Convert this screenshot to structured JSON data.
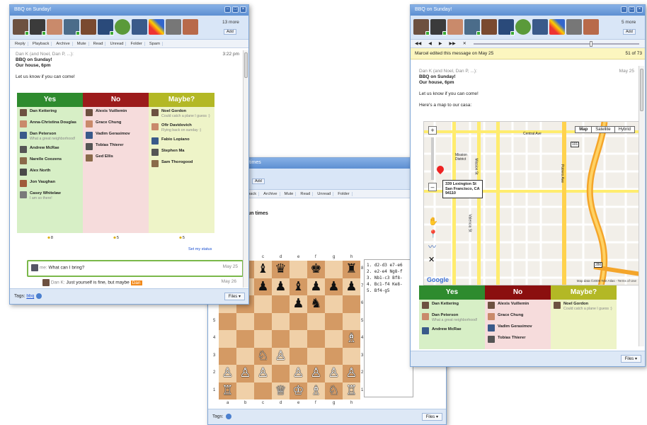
{
  "window_left": {
    "title": "BBQ on Sunday!",
    "more": "13 more",
    "add": "Add",
    "toolbar": [
      "Reply",
      "Playback",
      "Archive",
      "Mute",
      "Read",
      "Unread",
      "Folder",
      "Spam"
    ],
    "from": "Dan K (and Noel, Dan P, ...):",
    "time": "3:22 pm",
    "subject": "BBQ on Sunday!",
    "location": "Our house, 6pm",
    "body": "Let us know if you can come!",
    "poll": {
      "yes": {
        "label": "Yes",
        "color": "#2e8b2e",
        "items": [
          {
            "name": "Dan Kettering",
            "note": ""
          },
          {
            "name": "Anna-Christina Douglas",
            "note": ""
          },
          {
            "name": "Dan Peterson",
            "note": "What a great neighborhood!"
          },
          {
            "name": "Andrew McRae",
            "note": ""
          },
          {
            "name": "Narelle Coozens",
            "note": ""
          },
          {
            "name": "Alex North",
            "note": ""
          },
          {
            "name": "Jon Vaughan",
            "note": ""
          },
          {
            "name": "Casey Whitelaw",
            "note": "I am so there!"
          }
        ],
        "count": "8"
      },
      "no": {
        "label": "No",
        "color": "#a01f1f",
        "items": [
          {
            "name": "Alexis Vuillemin",
            "note": ""
          },
          {
            "name": "Grace Chung",
            "note": ""
          },
          {
            "name": "Vadim Gerasimov",
            "note": ""
          },
          {
            "name": "Tobias Thierer",
            "note": ""
          },
          {
            "name": "Ged Ellis",
            "note": ""
          }
        ],
        "count": "5"
      },
      "maybe": {
        "label": "Maybe?",
        "color": "#b7bc24",
        "items": [
          {
            "name": "Noel Gordon",
            "note": "Could catch a plane I guess :)"
          },
          {
            "name": "Ofir Davidovich",
            "note": "Flying back on sunday :)"
          },
          {
            "name": "Fabio Lopiano",
            "note": ""
          },
          {
            "name": "Stephen Ma",
            "note": ""
          },
          {
            "name": "Sam Thorogood",
            "note": ""
          }
        ],
        "count": "5"
      }
    },
    "set_status": "Set my status",
    "reply1": {
      "author": "me:",
      "text": "What can I bring?",
      "date": "May 25"
    },
    "reply2": {
      "author": "Dan K:",
      "text": "Just yourself is fine, but maybe",
      "tag": "Dan",
      "date": "May 26"
    },
    "tags_label": "Tags:",
    "tag": "bbq",
    "files": "Files"
  },
  "window_mid": {
    "title": "times",
    "add": "Add",
    "toolbar": [
      "yback",
      "Archive",
      "Mute",
      "Read",
      "Unread",
      "Folder"
    ],
    "heading": "un times",
    "files_label": "a b c d e f g h",
    "moves": [
      "1. d2-d3 e7-e6",
      "2. e2-e4 Ng8-f",
      "3. Nb1-c3 Bf8-",
      "4. Bc1-f4 Ke8-",
      "5. Bf4-g5"
    ],
    "ranks": [
      "8",
      "7",
      "6",
      "5",
      "4",
      "3",
      "2",
      "1"
    ],
    "file_letters": [
      "a",
      "b",
      "c",
      "d",
      "e",
      "f",
      "g",
      "h"
    ],
    "board": [
      [
        "",
        "",
        "♝",
        "♛",
        "",
        "♚",
        "",
        "♜"
      ],
      [
        "♟",
        "♟",
        "♟",
        "♟",
        "♝",
        "♟",
        "♟",
        "♟"
      ],
      [
        "",
        "",
        "",
        "",
        "♟",
        "♞",
        "",
        ""
      ],
      [
        "",
        "",
        "",
        "",
        "",
        "",
        "",
        ""
      ],
      [
        "",
        "",
        "",
        "",
        "",
        "",
        "",
        "♗"
      ],
      [
        "",
        "",
        "♘",
        "♙",
        "",
        "",
        "",
        ""
      ],
      [
        "♙",
        "♙",
        "♙",
        "",
        "♙",
        "♙",
        "♙",
        "♙"
      ],
      [
        "♖",
        "",
        "",
        "♕",
        "♔",
        "♗",
        "♘",
        "♖"
      ]
    ],
    "tags_label": "Tags:",
    "files": "Files"
  },
  "window_right": {
    "title": "BBQ on Sunday!",
    "more": "5 more",
    "add": "Add",
    "edited": "Marcel edited this message on May 25",
    "pages": "51 of 73",
    "from": "Dan K (and Noel, Dan P, ...):",
    "date": "May 25",
    "subject": "BBQ on Sunday!",
    "location": "Our house, 6pm",
    "body1": "Let us know if you can come!",
    "body2": "Here's a map to our casa:",
    "map": {
      "tabs": [
        "Map",
        "Satellite",
        "Hybrid"
      ],
      "marker": "339 Lexington St\nSan Francisco, CA\n94110",
      "streets": [
        "Mission District",
        "Central Ave",
        "Valencia St",
        "Mission St",
        "Potrero Ave",
        "101",
        "280"
      ],
      "logo": "Google",
      "copyright": "Map data ©2009 Tele Atlas - Terms of Use"
    },
    "poll": {
      "yes": {
        "label": "Yes",
        "color": "#2e8b2e",
        "items": [
          {
            "name": "Dan Kettering",
            "note": ""
          },
          {
            "name": "Dan Peterson",
            "note": "What a great neighborhood!"
          },
          {
            "name": "Andrew McRae",
            "note": ""
          }
        ]
      },
      "no": {
        "label": "No",
        "color": "#8b0f0f",
        "items": [
          {
            "name": "Alexis Vuillemin",
            "note": ""
          },
          {
            "name": "Grace Chung",
            "note": ""
          },
          {
            "name": "Vadim Gerasimov",
            "note": ""
          },
          {
            "name": "Tobias Thierer",
            "note": ""
          }
        ]
      },
      "maybe": {
        "label": "Maybe?",
        "color": "#b7bc24",
        "items": [
          {
            "name": "Noel Gordon",
            "note": "Could catch a plane I guess :)"
          }
        ]
      }
    },
    "files": "Files"
  }
}
